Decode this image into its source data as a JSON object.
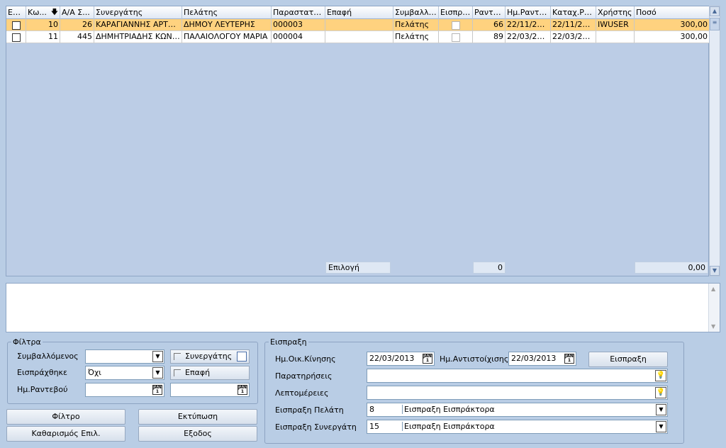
{
  "grid": {
    "columns": [
      "Επι...",
      "Κω...",
      "Α/Α Σ...",
      "Συνεργάτης",
      "Πελάτης",
      "Παραστατικό",
      "Επαφή",
      "Συμβαλλό...",
      "Εισπρά...",
      "Ραντε...",
      "Ημ.Ραντε...",
      "Καταχ.Ρα...",
      "Χρήστης",
      "Ποσό"
    ],
    "sort_icon": "sort-down-arrow-icon",
    "rows": [
      {
        "code": "10",
        "aa": "26",
        "partner": "ΚΑΡΑΓΙΑΝΝΗΣ ΑΡΤΕΜΙ...",
        "customer": "ΔΗΜΟΥ ΛΕΥΤΕΡΗΣ",
        "document": "000003",
        "contact": "",
        "contractor": "Πελάτης",
        "appt": "66",
        "appt_date": "22/11/201...",
        "reg_date": "22/11/2012",
        "user": "IWUSER",
        "amount": "300,00"
      },
      {
        "code": "11",
        "aa": "445",
        "partner": "ΔΗΜΗΤΡΙΑΔΗΣ ΚΩΝΣΤ...",
        "customer": "ΠΑΛΑΙΟΛΟΓΟΥ ΜΑΡΙΑ",
        "document": "000004",
        "contact": "",
        "contractor": "Πελάτης",
        "appt": "89",
        "appt_date": "22/03/201...",
        "reg_date": "22/03/2013",
        "user": "",
        "amount": "300,00"
      }
    ],
    "totals": {
      "label": "Επιλογή",
      "count": "0",
      "sum": "0,00"
    }
  },
  "filters": {
    "title": "Φίλτρα",
    "contractor_label": "Συμβαλλόμενος",
    "contractor_value": "",
    "collected_label": "Εισπράχθηκε",
    "collected_value": "Όχι",
    "appt_date_label": "Ημ.Ραντεβού",
    "partner_toggle": "Συνεργάτης",
    "contact_toggle": "Επαφή"
  },
  "buttons": {
    "filter": "Φίλτρο",
    "print": "Εκτύπωση",
    "clear": "Καθαρισμός Επιλ.",
    "exit": "Εξοδος",
    "collect": "Εισπραξη"
  },
  "collection": {
    "title": "Εισπραξη",
    "move_date_label": "Ημ.Οικ.Κίνησης",
    "move_date": "22/03/2013",
    "match_date_label": "Ημ.Αντιστοίχισης",
    "match_date": "22/03/2013",
    "notes_label": "Παρατηρήσεις",
    "details_label": "Λεπτομέρειες",
    "customer_collect_label": "Εισπραξη Πελάτη",
    "customer_collect_code": "8",
    "customer_collect_value": "Εισπραξη Εισπράκτορα",
    "partner_collect_label": "Εισπραξη Συνεργάτη",
    "partner_collect_code": "15",
    "partner_collect_value": "Εισπραξη Εισπράκτορα"
  },
  "calendar_icon_text": "JAN"
}
